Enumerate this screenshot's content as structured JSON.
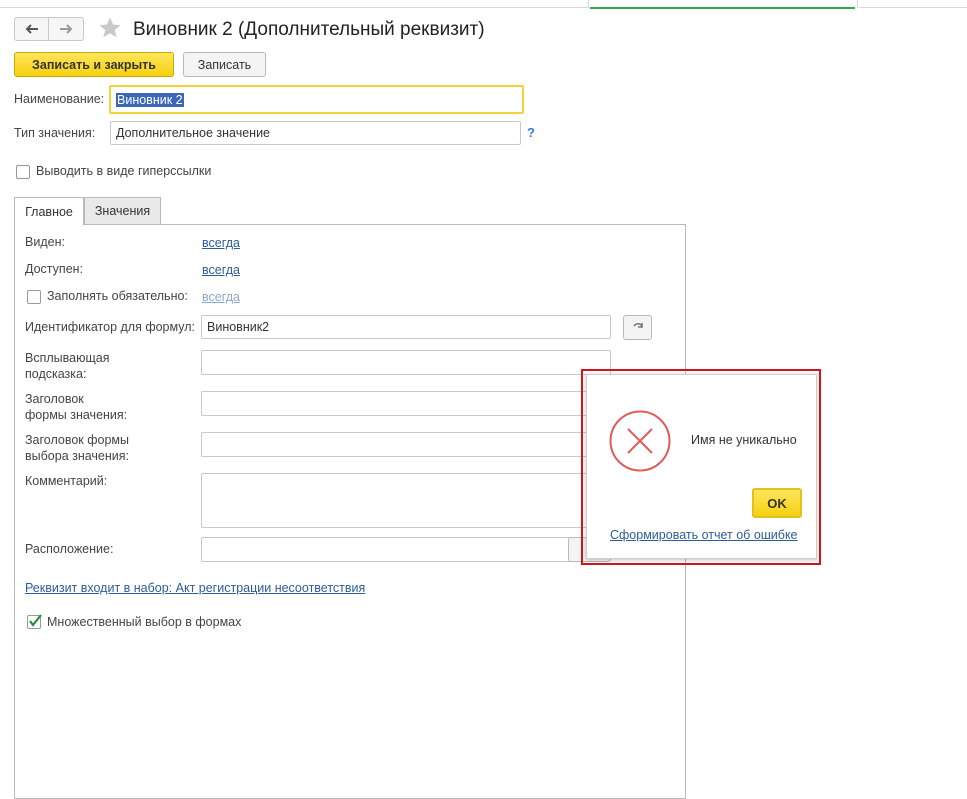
{
  "window": {
    "title": "Виновник 2 (Дополнительный реквизит)"
  },
  "toolbar": {
    "save_close_label": "Записать и закрыть",
    "save_label": "Записать"
  },
  "fields": {
    "name_label": "Наименование:",
    "name_value": "Виновник 2",
    "type_label": "Тип значения:",
    "type_value": "Дополнительное значение",
    "help_label": "?",
    "hyperlink_label": "Выводить в виде гиперссылки"
  },
  "tabs": [
    {
      "label": "Главное",
      "active": true
    },
    {
      "label": "Значения",
      "active": false
    }
  ],
  "main_tab": {
    "visible_label": "Виден:",
    "visible_value": "всегда",
    "available_label": "Доступен:",
    "available_value": "всегда",
    "required_label": "Заполнять обязательно:",
    "required_value": "всегда",
    "formula_id_label": "Идентификатор для формул:",
    "formula_id_value": "Виновник2",
    "tooltip_label_1": "Всплывающая",
    "tooltip_label_2": "подсказка:",
    "value_form_title_label_1": "Заголовок",
    "value_form_title_label_2": "формы значения:",
    "choice_form_title_label_1": "Заголовок формы",
    "choice_form_title_label_2": "выбора значения:",
    "comment_label": "Комментарий:",
    "location_label": "Расположение:",
    "location_button": "...",
    "set_link": "Реквизит входит в набор: Акт регистрации несоответствия",
    "multi_select_label": "Множественный выбор в формах",
    "multi_select_checked": true
  },
  "dialog": {
    "message": "Имя не уникально",
    "ok_label": "OK",
    "report_link": "Сформировать отчет об ошибке"
  },
  "colors": {
    "accent_yellow": "#f5d10f",
    "dialog_frame_red": "#d4121c",
    "error_icon_red": "#e15a5a",
    "link_blue": "#2d5d9a",
    "check_green": "#2e8b3a"
  }
}
